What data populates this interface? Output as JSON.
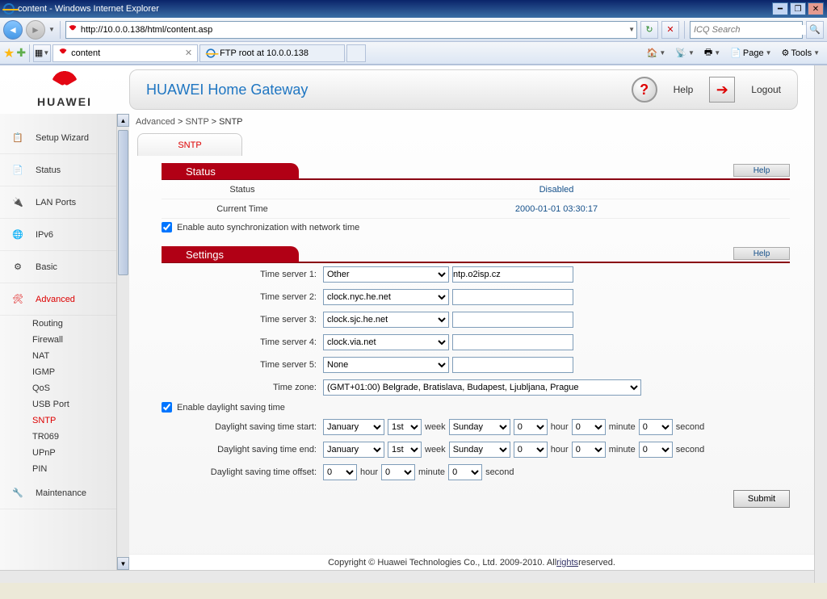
{
  "browser": {
    "window_title": "content - Windows Internet Explorer",
    "url": "http://10.0.0.138/html/content.asp",
    "search_placeholder": "ICQ Search",
    "tabs": [
      {
        "label": "content",
        "active": true
      },
      {
        "label": "FTP root at 10.0.0.138",
        "active": false
      }
    ],
    "toolbar": {
      "page_label": "Page",
      "tools_label": "Tools"
    }
  },
  "header": {
    "brand": "HUAWEI",
    "title": "HUAWEI Home Gateway",
    "help_label": "Help",
    "logout_label": "Logout"
  },
  "breadcrumb": {
    "l1": "Advanced",
    "l2": "SNTP",
    "l3": "SNTP",
    "sep": " > "
  },
  "tab": {
    "label": "SNTP"
  },
  "nav": {
    "items": [
      {
        "id": "setup-wizard",
        "label": "Setup Wizard"
      },
      {
        "id": "status",
        "label": "Status"
      },
      {
        "id": "lan-ports",
        "label": "LAN Ports"
      },
      {
        "id": "ipv6",
        "label": "IPv6"
      },
      {
        "id": "basic",
        "label": "Basic"
      },
      {
        "id": "advanced",
        "label": "Advanced",
        "active": true
      }
    ],
    "advanced_sub": [
      {
        "id": "routing",
        "label": "Routing"
      },
      {
        "id": "firewall",
        "label": "Firewall"
      },
      {
        "id": "nat",
        "label": "NAT"
      },
      {
        "id": "igmp",
        "label": "IGMP"
      },
      {
        "id": "qos",
        "label": "QoS"
      },
      {
        "id": "usb-port",
        "label": "USB Port"
      },
      {
        "id": "sntp",
        "label": "SNTP",
        "active": true
      },
      {
        "id": "tr069",
        "label": "TR069"
      },
      {
        "id": "upnp",
        "label": "UPnP"
      },
      {
        "id": "pin",
        "label": "PIN"
      }
    ],
    "maintenance_label": "Maintenance"
  },
  "status_section": {
    "title": "Status",
    "help_label": "Help",
    "status_label": "Status",
    "status_value": "Disabled",
    "time_label": "Current Time",
    "time_value": "2000-01-01 03:30:17",
    "autosync_label": "Enable auto synchronization with network time",
    "autosync_checked": true
  },
  "settings_section": {
    "title": "Settings",
    "help_label": "Help",
    "servers": [
      {
        "label": "Time server 1:",
        "select": "Other",
        "text": "ntp.o2isp.cz"
      },
      {
        "label": "Time server 2:",
        "select": "clock.nyc.he.net",
        "text": ""
      },
      {
        "label": "Time server 3:",
        "select": "clock.sjc.he.net",
        "text": ""
      },
      {
        "label": "Time server 4:",
        "select": "clock.via.net",
        "text": ""
      },
      {
        "label": "Time server 5:",
        "select": "None",
        "text": ""
      }
    ],
    "tz_label": "Time zone:",
    "tz_value": "(GMT+01:00) Belgrade, Bratislava, Budapest, Ljubljana, Prague",
    "dst_enable_label": "Enable daylight saving time",
    "dst_enable_checked": true,
    "dst_start_label": "Daylight saving time start:",
    "dst_end_label": "Daylight saving time end:",
    "dst_offset_label": "Daylight saving time offset:",
    "month_value": "January",
    "week_ord_value": "1st",
    "week_word": "week",
    "day_value": "Sunday",
    "hour_value": "0",
    "hour_word": "hour",
    "minute_value": "0",
    "minute_word": "minute",
    "second_value": "0",
    "second_word": "second",
    "offset_hour": "0",
    "offset_minute": "0",
    "offset_second": "0",
    "submit_label": "Submit"
  },
  "footer": {
    "text_prefix": "Copyright © Huawei Technologies Co., Ltd. 2009-2010. All ",
    "link": "rights",
    "text_suffix": " reserved."
  }
}
